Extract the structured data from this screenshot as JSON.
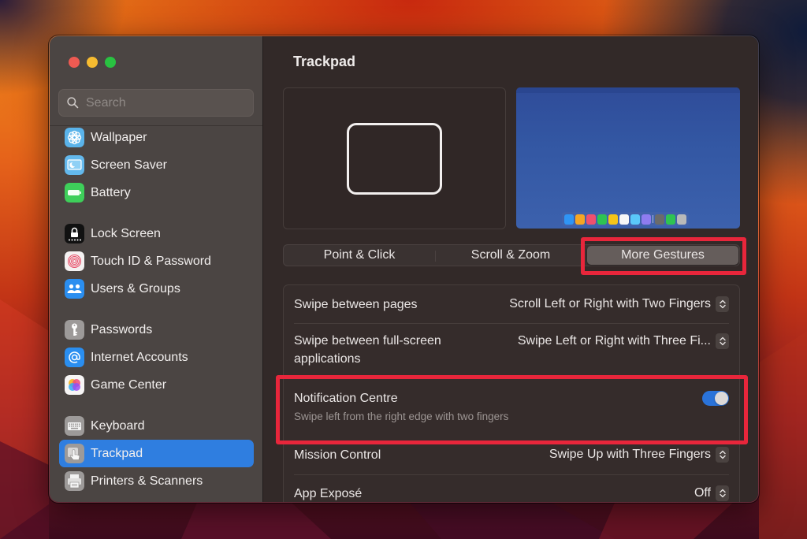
{
  "window": {
    "title": "Trackpad",
    "controls": [
      "close",
      "minimize",
      "zoom"
    ]
  },
  "search": {
    "placeholder": "Search",
    "value": ""
  },
  "sidebar": {
    "items": [
      {
        "label": "Wallpaper",
        "icon": "wallpaper-icon",
        "active": false
      },
      {
        "label": "Screen Saver",
        "icon": "screen-saver-icon",
        "active": false
      },
      {
        "label": "Battery",
        "icon": "battery-icon",
        "active": false
      },
      {
        "label": "Lock Screen",
        "icon": "lock-icon",
        "active": false
      },
      {
        "label": "Touch ID & Password",
        "icon": "fingerprint-icon",
        "active": false
      },
      {
        "label": "Users & Groups",
        "icon": "users-icon",
        "active": false
      },
      {
        "label": "Passwords",
        "icon": "key-icon",
        "active": false
      },
      {
        "label": "Internet Accounts",
        "icon": "at-sign-icon",
        "active": false
      },
      {
        "label": "Game Center",
        "icon": "game-center-icon",
        "active": false
      },
      {
        "label": "Keyboard",
        "icon": "keyboard-icon",
        "active": false
      },
      {
        "label": "Trackpad",
        "icon": "trackpad-icon",
        "active": true
      },
      {
        "label": "Printers & Scanners",
        "icon": "printer-icon",
        "active": false
      }
    ]
  },
  "main": {
    "title": "Trackpad",
    "tabs": [
      {
        "label": "Point & Click",
        "active": false
      },
      {
        "label": "Scroll & Zoom",
        "active": false
      },
      {
        "label": "More Gestures",
        "active": true
      }
    ],
    "settings": [
      {
        "label": "Swipe between pages",
        "value": "Scroll Left or Right with Two Fingers",
        "control": "popup"
      },
      {
        "label": "Swipe between full-screen applications",
        "label_line1": "Swipe between full-screen",
        "label_line2": "applications",
        "value": "Swipe Left or Right with Three Fi...",
        "control": "popup"
      },
      {
        "label": "Notification Centre",
        "description": "Swipe left from the right edge with two fingers",
        "control": "toggle",
        "enabled": true
      },
      {
        "label": "Mission Control",
        "value": "Swipe Up with Three Fingers",
        "control": "popup"
      },
      {
        "label": "App Exposé",
        "value": "Off",
        "control": "popup"
      }
    ]
  },
  "dock_colors": [
    "#2f95f5",
    "#f5a623",
    "#f0506e",
    "#2ec452",
    "#f5c518",
    "#f7f7f7",
    "#5ac8fa",
    "#8e7cf0",
    "#6b6b6b",
    "#2ec452",
    "#b9b9b9"
  ],
  "colors": {
    "accent": "#2f7ee0",
    "highlight": "#e8263b",
    "toggle_on": "#2a73d9"
  }
}
